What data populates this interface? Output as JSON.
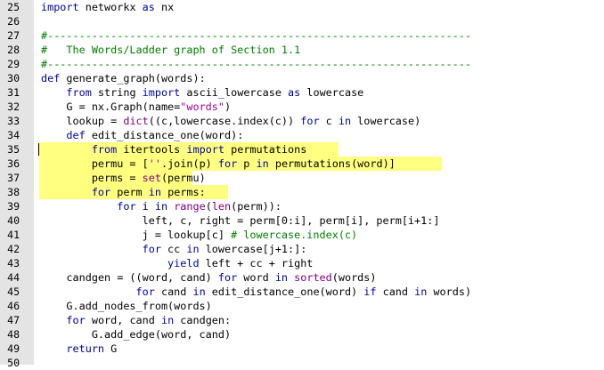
{
  "editor": {
    "lines": [
      {
        "n": "25",
        "t": [
          {
            "k": "kw",
            "s": "import"
          },
          {
            "k": "nm",
            "s": " networkx "
          },
          {
            "k": "kw",
            "s": "as"
          },
          {
            "k": "nm",
            "s": " nx"
          }
        ]
      },
      {
        "n": "26",
        "t": []
      },
      {
        "n": "27",
        "t": [
          {
            "k": "cm",
            "s": "#-------------------------------------------------------------------"
          }
        ]
      },
      {
        "n": "28",
        "t": [
          {
            "k": "cm",
            "s": "#   The Words/Ladder graph of Section 1.1"
          }
        ]
      },
      {
        "n": "29",
        "t": [
          {
            "k": "cm",
            "s": "#-------------------------------------------------------------------"
          }
        ]
      },
      {
        "n": "30",
        "t": [
          {
            "k": "kw",
            "s": "def"
          },
          {
            "k": "nm",
            "s": " generate_graph(words):"
          }
        ]
      },
      {
        "n": "31",
        "t": [
          {
            "k": "nm",
            "s": "    "
          },
          {
            "k": "kw",
            "s": "from"
          },
          {
            "k": "nm",
            "s": " string "
          },
          {
            "k": "kw",
            "s": "import"
          },
          {
            "k": "nm",
            "s": " ascii_lowercase "
          },
          {
            "k": "kw",
            "s": "as"
          },
          {
            "k": "nm",
            "s": " lowercase"
          }
        ]
      },
      {
        "n": "32",
        "t": [
          {
            "k": "nm",
            "s": "    G = nx.Graph(name="
          },
          {
            "k": "st",
            "s": "\"words\""
          },
          {
            "k": "nm",
            "s": ")"
          }
        ]
      },
      {
        "n": "33",
        "t": [
          {
            "k": "nm",
            "s": "    lookup = "
          },
          {
            "k": "bi",
            "s": "dict"
          },
          {
            "k": "nm",
            "s": "((c,lowercase.index(c)) "
          },
          {
            "k": "kw",
            "s": "for"
          },
          {
            "k": "nm",
            "s": " c "
          },
          {
            "k": "kw",
            "s": "in"
          },
          {
            "k": "nm",
            "s": " lowercase)"
          }
        ]
      },
      {
        "n": "34",
        "t": [
          {
            "k": "nm",
            "s": "    "
          },
          {
            "k": "kw",
            "s": "def"
          },
          {
            "k": "nm",
            "s": " edit_distance_one(word):"
          }
        ]
      },
      {
        "n": "35",
        "t": [
          {
            "k": "nm",
            "s": "        "
          },
          {
            "k": "kw",
            "s": "from"
          },
          {
            "k": "nm",
            "s": " itertools "
          },
          {
            "k": "kw",
            "s": "import"
          },
          {
            "k": "nm",
            "s": " permutations"
          }
        ]
      },
      {
        "n": "36",
        "t": [
          {
            "k": "nm",
            "s": "        permu = ["
          },
          {
            "k": "st",
            "s": "''"
          },
          {
            "k": "nm",
            "s": ".join(p) "
          },
          {
            "k": "kw",
            "s": "for"
          },
          {
            "k": "nm",
            "s": " p "
          },
          {
            "k": "kw",
            "s": "in"
          },
          {
            "k": "nm",
            "s": " permutations(word)]"
          }
        ]
      },
      {
        "n": "37",
        "t": [
          {
            "k": "nm",
            "s": "        perms = "
          },
          {
            "k": "bi",
            "s": "set"
          },
          {
            "k": "nm",
            "s": "(permu)"
          }
        ]
      },
      {
        "n": "38",
        "t": [
          {
            "k": "nm",
            "s": "        "
          },
          {
            "k": "kw",
            "s": "for"
          },
          {
            "k": "nm",
            "s": " perm "
          },
          {
            "k": "kw",
            "s": "in"
          },
          {
            "k": "nm",
            "s": " perms:"
          }
        ]
      },
      {
        "n": "39",
        "t": [
          {
            "k": "nm",
            "s": "            "
          },
          {
            "k": "kw",
            "s": "for"
          },
          {
            "k": "nm",
            "s": " i "
          },
          {
            "k": "kw",
            "s": "in"
          },
          {
            "k": "nm",
            "s": " "
          },
          {
            "k": "bi",
            "s": "range"
          },
          {
            "k": "nm",
            "s": "("
          },
          {
            "k": "bi",
            "s": "len"
          },
          {
            "k": "nm",
            "s": "(perm)):"
          }
        ]
      },
      {
        "n": "40",
        "t": [
          {
            "k": "nm",
            "s": "                left, c, right = perm[0:i], perm[i], perm[i+1:]"
          }
        ]
      },
      {
        "n": "41",
        "t": [
          {
            "k": "nm",
            "s": "                j = lookup[c] "
          },
          {
            "k": "cm",
            "s": "# lowercase.index(c)"
          }
        ]
      },
      {
        "n": "42",
        "t": [
          {
            "k": "nm",
            "s": "                "
          },
          {
            "k": "kw",
            "s": "for"
          },
          {
            "k": "nm",
            "s": " cc "
          },
          {
            "k": "kw",
            "s": "in"
          },
          {
            "k": "nm",
            "s": " lowercase[j+1:]:"
          }
        ]
      },
      {
        "n": "43",
        "t": [
          {
            "k": "nm",
            "s": "                    "
          },
          {
            "k": "kw",
            "s": "yield"
          },
          {
            "k": "nm",
            "s": " left + cc + right"
          }
        ]
      },
      {
        "n": "44",
        "t": [
          {
            "k": "nm",
            "s": "    candgen = ((word, cand) "
          },
          {
            "k": "kw",
            "s": "for"
          },
          {
            "k": "nm",
            "s": " word "
          },
          {
            "k": "kw",
            "s": "in"
          },
          {
            "k": "nm",
            "s": " "
          },
          {
            "k": "bi",
            "s": "sorted"
          },
          {
            "k": "nm",
            "s": "(words)"
          }
        ]
      },
      {
        "n": "45",
        "t": [
          {
            "k": "nm",
            "s": "               "
          },
          {
            "k": "kw",
            "s": "for"
          },
          {
            "k": "nm",
            "s": " cand "
          },
          {
            "k": "kw",
            "s": "in"
          },
          {
            "k": "nm",
            "s": " edit_distance_one(word) "
          },
          {
            "k": "kw",
            "s": "if"
          },
          {
            "k": "nm",
            "s": " cand "
          },
          {
            "k": "kw",
            "s": "in"
          },
          {
            "k": "nm",
            "s": " words)"
          }
        ]
      },
      {
        "n": "46",
        "t": [
          {
            "k": "nm",
            "s": "    G.add_nodes_from(words)"
          }
        ]
      },
      {
        "n": "47",
        "t": [
          {
            "k": "nm",
            "s": "    "
          },
          {
            "k": "kw",
            "s": "for"
          },
          {
            "k": "nm",
            "s": " word, cand "
          },
          {
            "k": "kw",
            "s": "in"
          },
          {
            "k": "nm",
            "s": " candgen:"
          }
        ]
      },
      {
        "n": "48",
        "t": [
          {
            "k": "nm",
            "s": "        G.add_edge(word, cand)"
          }
        ]
      },
      {
        "n": "49",
        "t": [
          {
            "k": "nm",
            "s": "    "
          },
          {
            "k": "kw",
            "s": "return"
          },
          {
            "k": "nm",
            "s": " G"
          }
        ]
      },
      {
        "n": "50",
        "t": []
      }
    ],
    "highlighted_lines": [
      "35",
      "36",
      "37",
      "38"
    ],
    "caret_line": "35",
    "colors": {
      "gutter": "#e4e4e4",
      "highlight": "#ffff80",
      "keyword": "#0000a0",
      "comment": "#008000",
      "string": "#a000a0",
      "builtin": "#800080"
    }
  }
}
